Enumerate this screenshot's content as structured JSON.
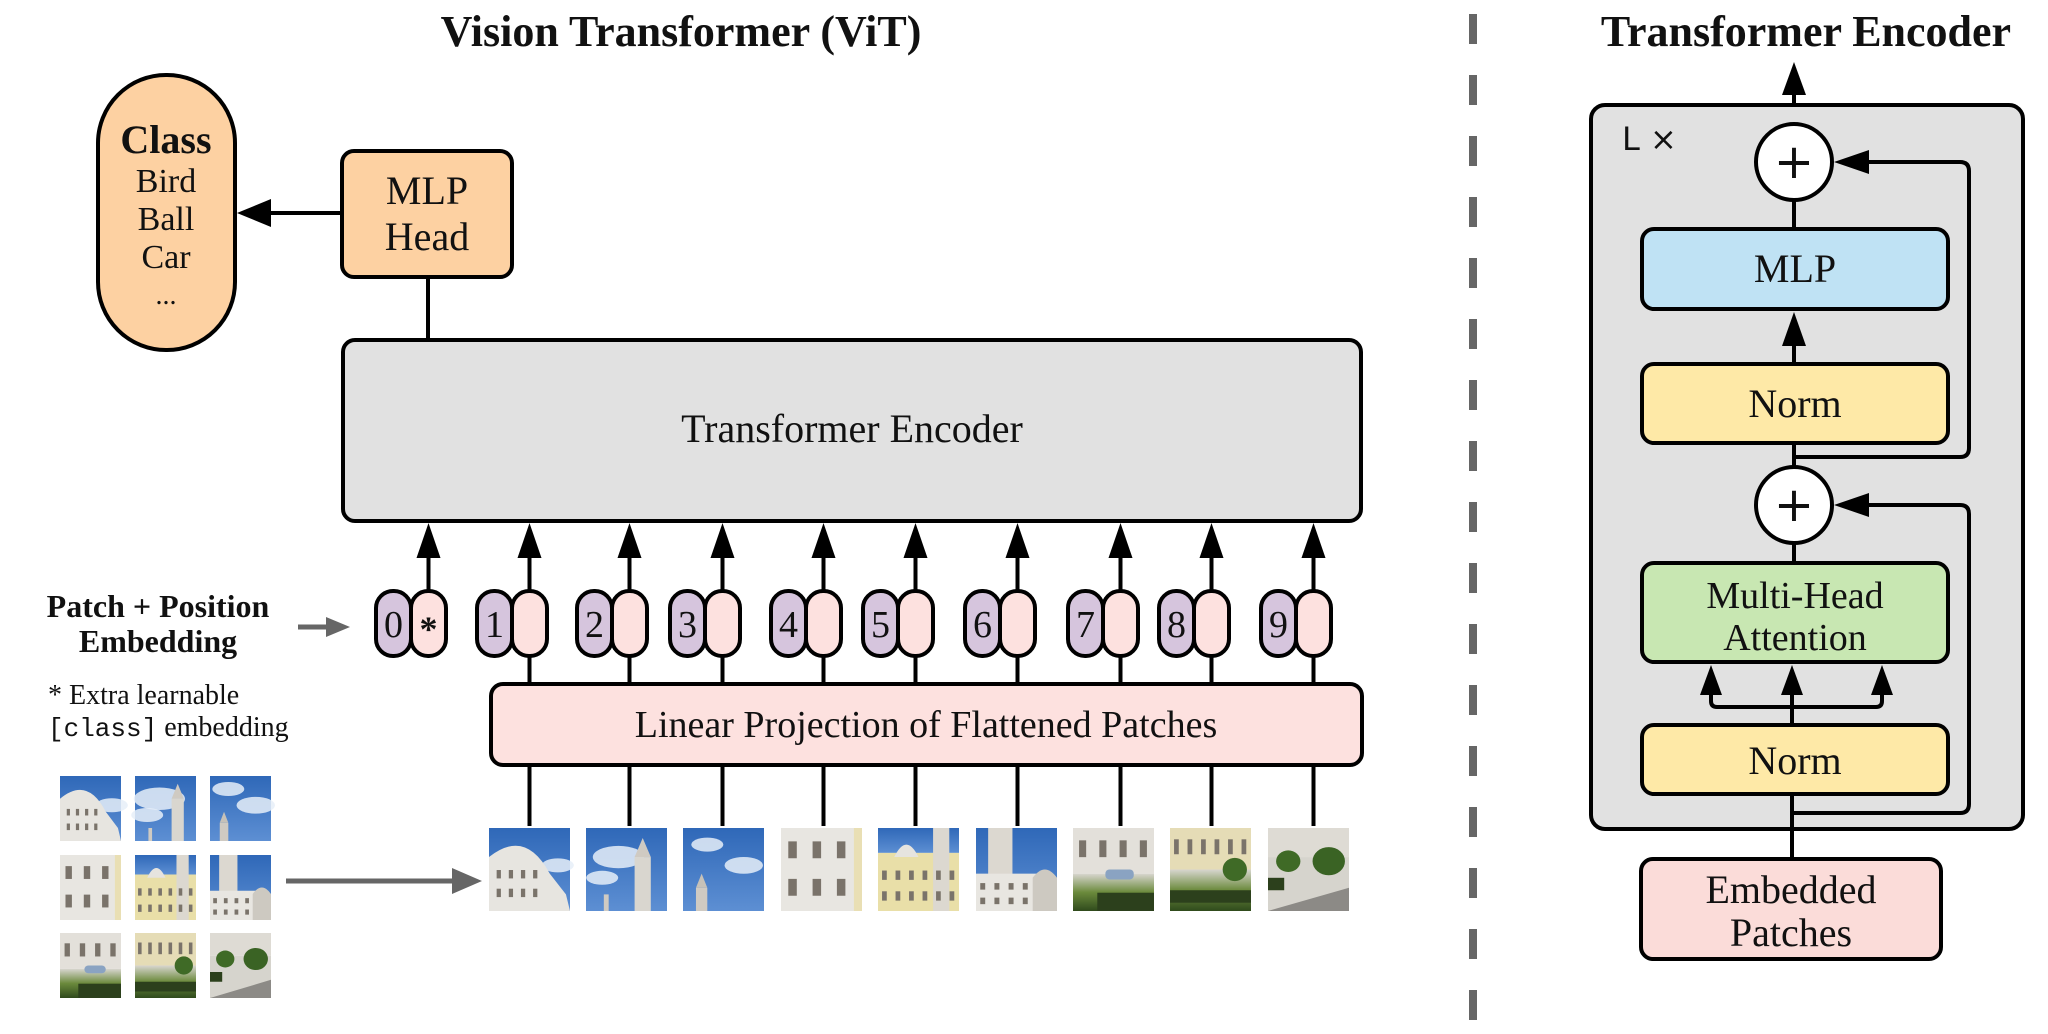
{
  "colors": {
    "orange": "#fdd1a2",
    "encoder_gray": "#e1e1e1",
    "position_purple": "#d6c5dd",
    "patch_pink": "#fde1df",
    "projection_pink": "#fde1df",
    "mlp_blue": "#bfe2f4",
    "norm_yellow": "#fee9a7",
    "attention_green": "#c8e7b2",
    "embedded_pink": "#fbdcd9",
    "divider": "#666666"
  },
  "vit": {
    "title": "Vision Transformer (ViT)",
    "class_box": {
      "heading": "Class",
      "items": [
        "Bird",
        "Ball",
        "Car",
        "..."
      ]
    },
    "mlp_head": {
      "line1": "MLP",
      "line2": "Head"
    },
    "encoder_label": "Transformer Encoder",
    "embedding_label": {
      "line1": "Patch + Position",
      "line2": "Embedding"
    },
    "footnote": {
      "line1": "* Extra learnable",
      "line2_code": "[class]",
      "line2_rest": " embedding"
    },
    "tokens": [
      {
        "position": "0",
        "content": "*"
      },
      {
        "position": "1",
        "content": ""
      },
      {
        "position": "2",
        "content": ""
      },
      {
        "position": "3",
        "content": ""
      },
      {
        "position": "4",
        "content": ""
      },
      {
        "position": "5",
        "content": ""
      },
      {
        "position": "6",
        "content": ""
      },
      {
        "position": "7",
        "content": ""
      },
      {
        "position": "8",
        "content": ""
      },
      {
        "position": "9",
        "content": ""
      }
    ],
    "projection_label": "Linear Projection of Flattened Patches",
    "patches": [
      {
        "scene": "dome-sky"
      },
      {
        "scene": "sky-tower"
      },
      {
        "scene": "sky-spire"
      },
      {
        "scene": "facade-white"
      },
      {
        "scene": "facade-yellow"
      },
      {
        "scene": "tower-facade"
      },
      {
        "scene": "plaza-cars"
      },
      {
        "scene": "garden-yellow"
      },
      {
        "scene": "garden-road"
      }
    ]
  },
  "encoder_detail": {
    "title": "Transformer Encoder",
    "repeat_label": "L ×",
    "add_symbol": "+",
    "mlp_label": "MLP",
    "norm_label": "Norm",
    "attention": {
      "line1": "Multi-Head",
      "line2": "Attention"
    },
    "input": {
      "line1": "Embedded",
      "line2": "Patches"
    }
  }
}
